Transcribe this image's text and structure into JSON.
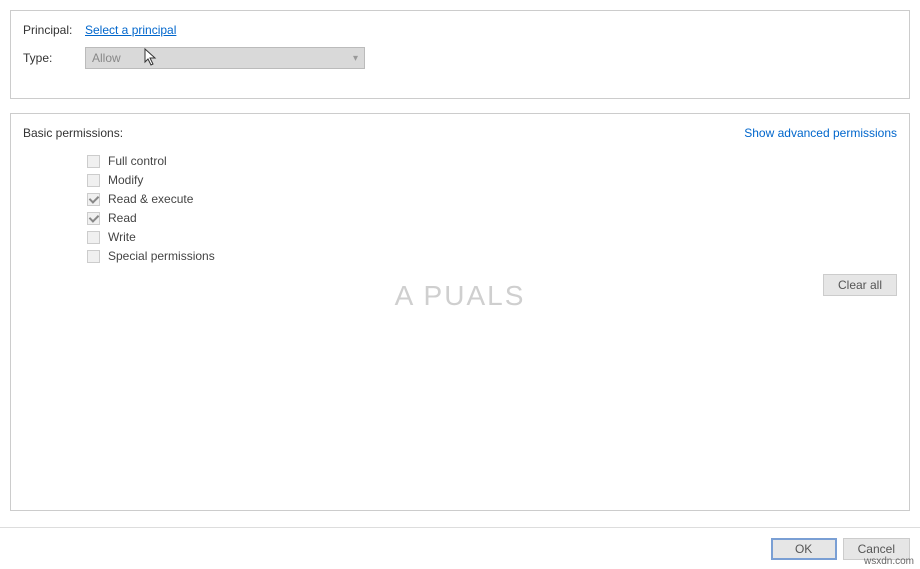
{
  "top": {
    "principal_label": "Principal:",
    "principal_link": "Select a principal",
    "type_label": "Type:",
    "type_value": "Allow"
  },
  "main": {
    "heading": "Basic permissions:",
    "advanced_link": "Show advanced permissions",
    "perms": {
      "full_control": "Full control",
      "modify": "Modify",
      "read_execute": "Read & execute",
      "read": "Read",
      "write": "Write",
      "special": "Special permissions"
    },
    "clear_all": "Clear all"
  },
  "buttons": {
    "ok": "OK",
    "cancel": "Cancel"
  },
  "watermark": {
    "logo": "A PUALS",
    "source": "wsxdn.com"
  }
}
